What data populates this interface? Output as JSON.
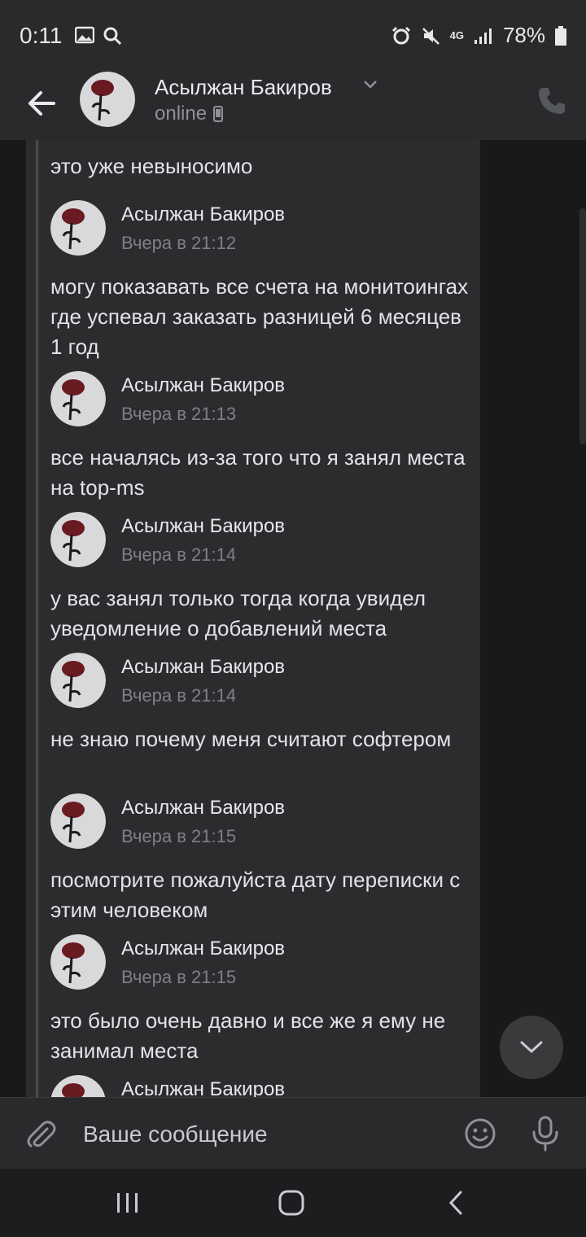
{
  "status_bar": {
    "time": "0:11",
    "network": "4G",
    "battery": "78%"
  },
  "header": {
    "back_icon": "arrow-left-icon",
    "name": "Асылжан Бакиров",
    "status": "online",
    "call_icon": "phone-icon"
  },
  "messages": [
    {
      "text": "это уже невыносимо"
    },
    {
      "name": "Асылжан Бакиров",
      "time": "Вчера в 21:12",
      "text": "могу показавать все счета на монитоингах где успевал заказать разницей 6 месяцев 1 год"
    },
    {
      "name": "Асылжан Бакиров",
      "time": "Вчера в 21:13",
      "text": "все началясь из-за того что я занял места на top-ms"
    },
    {
      "name": "Асылжан Бакиров",
      "time": "Вчера в 21:14",
      "text": "у вас занял только тогда когда увидел уведомление о добавлений места"
    },
    {
      "name": "Асылжан Бакиров",
      "time": "Вчера в 21:14",
      "text": "не знаю почему меня считают софтером"
    },
    {
      "name": "Асылжан Бакиров",
      "time": "Вчера в 21:15",
      "text": "посмотрите пожалуйста дату переписки с этим человеком"
    },
    {
      "name": "Асылжан Бакиров",
      "time": "Вчера в 21:15",
      "text": "это было очень давно и все же я ему не занимал места"
    },
    {
      "name": "Асылжан Бакиров"
    }
  ],
  "composer": {
    "placeholder": "Ваше сообщение"
  },
  "colors": {
    "background": "#19191a",
    "bar": "#2a2a2c",
    "card": "#2c2c2e",
    "text": "#e1e3e6",
    "secondary": "#7d8085"
  }
}
